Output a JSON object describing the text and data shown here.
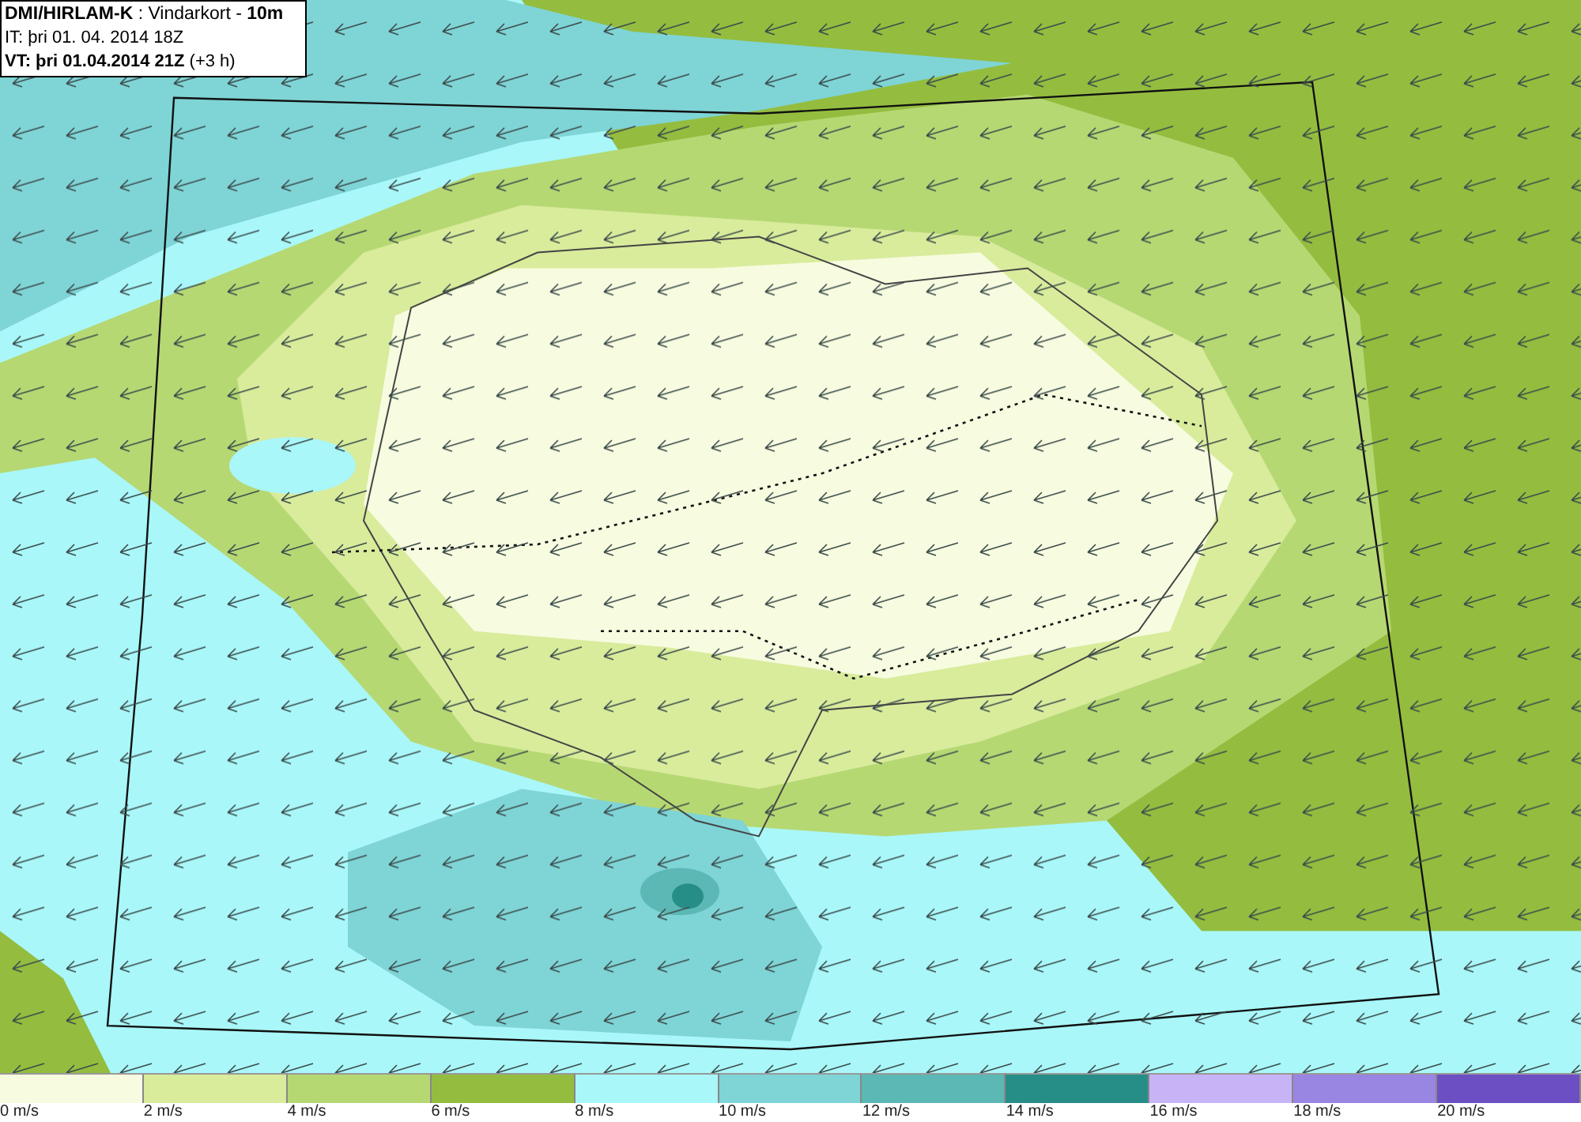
{
  "header": {
    "lines": [
      "**DMI/HIRLAM-K** : Vindarkort - **10m**",
      "IT: þri 01. 04. 2014 18Z",
      "**VT: þri 01.04.2014 21Z** (+3 h)"
    ]
  },
  "legend": [
    {
      "label": "0 m/s",
      "color": "#f7fbdf"
    },
    {
      "label": "2 m/s",
      "color": "#d8ec9c"
    },
    {
      "label": "4 m/s",
      "color": "#b6d873"
    },
    {
      "label": "6 m/s",
      "color": "#94bd3f"
    },
    {
      "label": "8 m/s",
      "color": "#a9f7f9"
    },
    {
      "label": "10 m/s",
      "color": "#7fd4d6"
    },
    {
      "label": "12 m/s",
      "color": "#5cb8b4"
    },
    {
      "label": "14 m/s",
      "color": "#268e87"
    },
    {
      "label": "16 m/s",
      "color": "#c7b4f7"
    },
    {
      "label": "18 m/s",
      "color": "#9985e2"
    },
    {
      "label": "20 m/s",
      "color": "#6d4fc4"
    }
  ]
}
